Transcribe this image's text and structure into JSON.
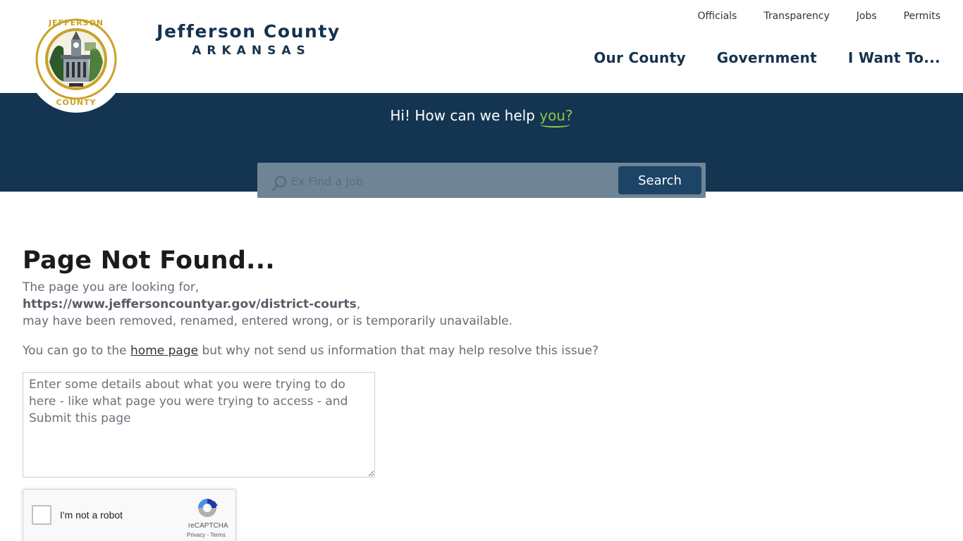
{
  "header": {
    "logo_alt": "Jefferson County seal",
    "brand_name": "Jefferson County",
    "brand_state": "ARKANSAS",
    "utility_nav": [
      {
        "label": "Officials"
      },
      {
        "label": "Transparency"
      },
      {
        "label": "Jobs"
      },
      {
        "label": "Permits"
      }
    ],
    "main_nav": [
      {
        "label": "Our County"
      },
      {
        "label": "Government"
      },
      {
        "label": "I Want To..."
      }
    ]
  },
  "hero": {
    "greeting": "Hi! How can we help ",
    "greeting_accent": "you?",
    "search_placeholder": "Ex Find a Job",
    "search_value": "",
    "search_button": "Search",
    "icon": "search-icon"
  },
  "content": {
    "title": "Page Not Found...",
    "line1": "The page you are looking for,",
    "missing_url": "https://www.jeffersoncountyar.gov/district-courts",
    "url_suffix": ",",
    "line3": "may have been removed, renamed, entered wrong, or is temporarily unavailable.",
    "help_prefix": "You can go to the ",
    "home_link": "home page",
    "help_suffix": " but why not send us information that may help resolve this issue?",
    "details_placeholder": "Enter some details about what you were trying to do here - like what page you were trying to access - and Submit this page",
    "details_value": ""
  },
  "recaptcha": {
    "label": "I'm not a robot",
    "brand": "reCAPTCHA",
    "links": "Privacy - Terms",
    "checked": false
  },
  "colors": {
    "navy": "#133552",
    "brand_text": "#15324f",
    "accent_green": "#8fc646",
    "search_button": "#1c4466",
    "seal_gold": "#c9a227"
  }
}
